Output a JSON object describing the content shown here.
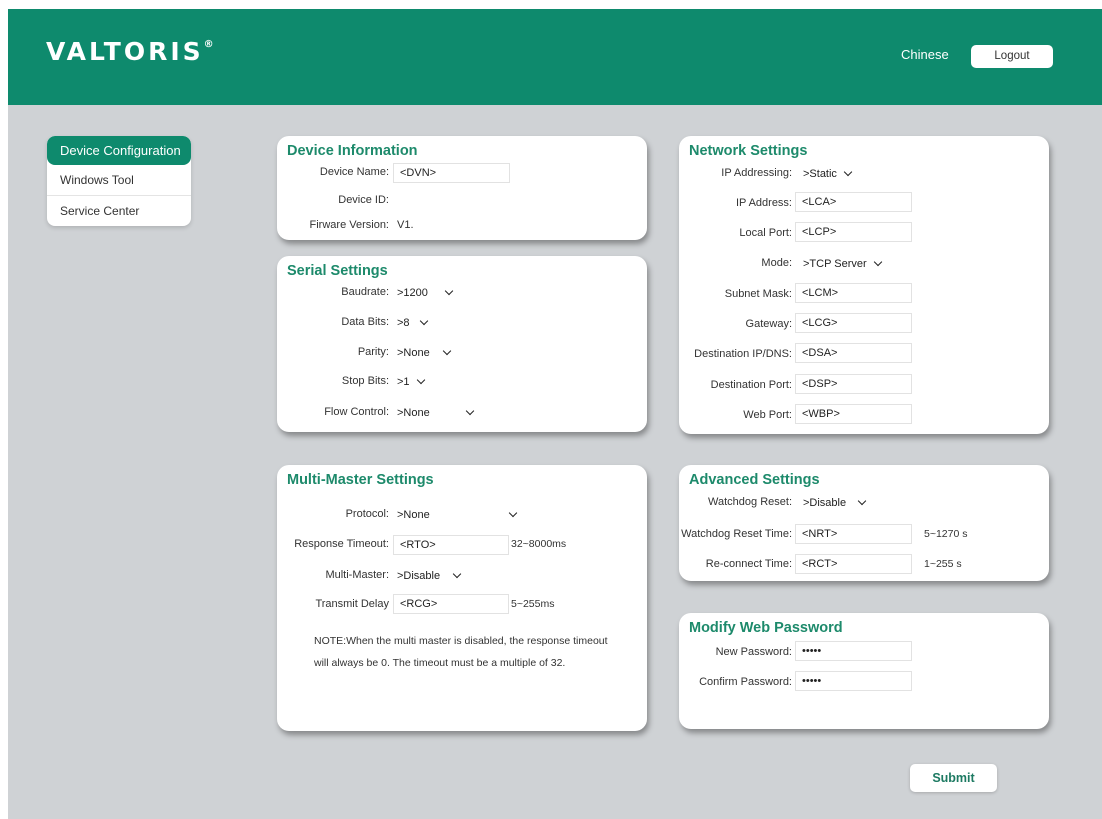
{
  "header": {
    "logo_text": "VALTORIS",
    "logo_mark": "®",
    "language": "Chinese",
    "logout": "Logout",
    "brand_color": "#0e8a6d"
  },
  "sidebar": {
    "items": [
      {
        "label": "Device Configuration",
        "active": true
      },
      {
        "label": "Windows Tool"
      },
      {
        "label": "Service Center"
      }
    ]
  },
  "device_info": {
    "title": "Device Information",
    "name_label": "Device Name:",
    "name_value": "<DVN>",
    "id_label": "Device ID:",
    "id_value": "",
    "fw_label": "Firware Version:",
    "fw_value": "V1."
  },
  "serial": {
    "title": "Serial Settings",
    "baud_label": "Baudrate:",
    "baud_value": ">1200",
    "databits_label": "Data Bits:",
    "databits_value": ">8",
    "parity_label": "Parity:",
    "parity_value": ">None",
    "stopbits_label": "Stop Bits:",
    "stopbits_value": ">1",
    "flow_label": "Flow Control:",
    "flow_value": ">None"
  },
  "multi_master": {
    "title": "Multi-Master Settings",
    "protocol_label": "Protocol:",
    "protocol_value": ">None",
    "timeout_label": "Response Timeout:",
    "timeout_value": "<RTO>",
    "timeout_range": "32~8000ms",
    "mm_label": "Multi-Master:",
    "mm_value": ">Disable",
    "delay_label": "Transmit Delay",
    "delay_value": "<RCG>",
    "delay_range": "5~255ms",
    "note_line1": "NOTE:When the multi master is disabled, the response timeout",
    "note_line2": "will always be 0. The timeout must be a multiple of 32."
  },
  "network": {
    "title": "Network Settings",
    "addressing_label": "IP Addressing:",
    "addressing_value": ">Static",
    "ip_label": "IP Address:",
    "ip_value": "<LCA>",
    "port_label": "Local Port:",
    "port_value": "<LCP>",
    "mode_label": "Mode:",
    "mode_value": ">TCP Server",
    "mask_label": "Subnet Mask:",
    "mask_value": "<LCM>",
    "gw_label": "Gateway:",
    "gw_value": "<LCG>",
    "dst_label": "Destination IP/DNS:",
    "dst_value": "<DSA>",
    "dport_label": "Destination Port:",
    "dport_value": "<DSP>",
    "web_label": "Web Port:",
    "web_value": "<WBP>"
  },
  "advanced": {
    "title": "Advanced Settings",
    "wd_label": "Watchdog Reset:",
    "wd_value": ">Disable",
    "wdt_label": "Watchdog Reset Time:",
    "wdt_value": "<NRT>",
    "wdt_range": "5~1270 s",
    "rc_label": "Re-connect Time:",
    "rc_value": "<RCT>",
    "rc_range": "1~255 s"
  },
  "password": {
    "title": "Modify Web Password",
    "new_label": "New Password:",
    "new_value": "•••••",
    "confirm_label": "Confirm Password:",
    "confirm_value": "•••••"
  },
  "submit": "Submit"
}
